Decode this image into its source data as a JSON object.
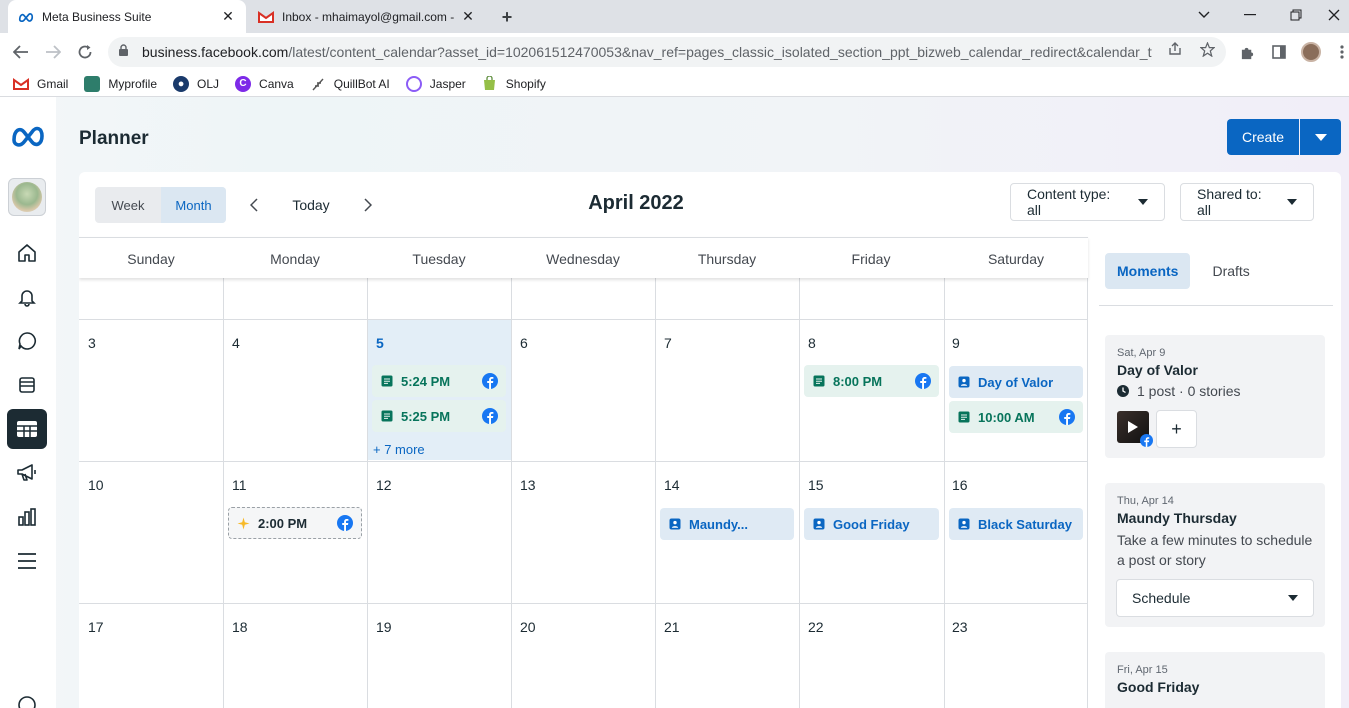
{
  "browser": {
    "tabs": [
      {
        "title": "Meta Business Suite",
        "close": "✕"
      },
      {
        "title": "Inbox - mhaimayol@gmail.com -",
        "close": "✕"
      }
    ],
    "new_tab": "+",
    "url_host": "business.facebook.com",
    "url_path": "/latest/content_calendar?asset_id=102061512470053&nav_ref=pages_classic_isolated_section_ppt_bizweb_calendar_redirect&calendar_type...",
    "bookmarks": [
      "Gmail",
      "Myprofile",
      "OLJ",
      "Canva",
      "QuillBot AI",
      "Jasper",
      "Shopify"
    ]
  },
  "app": {
    "title": "Planner",
    "create_label": "Create",
    "view_toggle": {
      "week": "Week",
      "month": "Month",
      "selected": "Month"
    },
    "today_label": "Today",
    "month_title": "April 2022",
    "filters": {
      "content_type": "Content type: all",
      "shared_to": "Shared to: all"
    },
    "days_of_week": [
      "Sunday",
      "Monday",
      "Tuesday",
      "Wednesday",
      "Thursday",
      "Friday",
      "Saturday"
    ],
    "weeks": [
      [
        "3",
        "4",
        "5",
        "6",
        "7",
        "8",
        "9"
      ],
      [
        "10",
        "11",
        "12",
        "13",
        "14",
        "15",
        "16"
      ],
      [
        "17",
        "18",
        "19",
        "20",
        "21",
        "22",
        "23"
      ]
    ],
    "events": {
      "tue5_a": "5:24 PM",
      "tue5_b": "5:25 PM",
      "tue5_more": "+ 7 more",
      "fri8": "8:00 PM",
      "sat9_moment": "Day of Valor",
      "sat9_post": "10:00 AM",
      "mon11_draft": "2:00 PM",
      "thu14_moment": "Maundy...",
      "fri15_moment": "Good Friday",
      "sat16_moment": "Black Saturday"
    },
    "right_panel": {
      "tabs": [
        "Moments",
        "Drafts"
      ],
      "selected_tab": "Moments",
      "cards": [
        {
          "date": "Sat, Apr 9",
          "title": "Day of Valor",
          "stats": "1 post · 0 stories",
          "add": "+"
        },
        {
          "date": "Thu, Apr 14",
          "title": "Maundy Thursday",
          "text": "Take a few minutes to schedule a post or story",
          "select": "Schedule"
        },
        {
          "date": "Fri, Apr 15",
          "title": "Good Friday"
        }
      ]
    }
  },
  "colors": {
    "brand_blue": "#0a66c2",
    "post_green": "#07745b",
    "facebook_blue": "#1877f2"
  }
}
